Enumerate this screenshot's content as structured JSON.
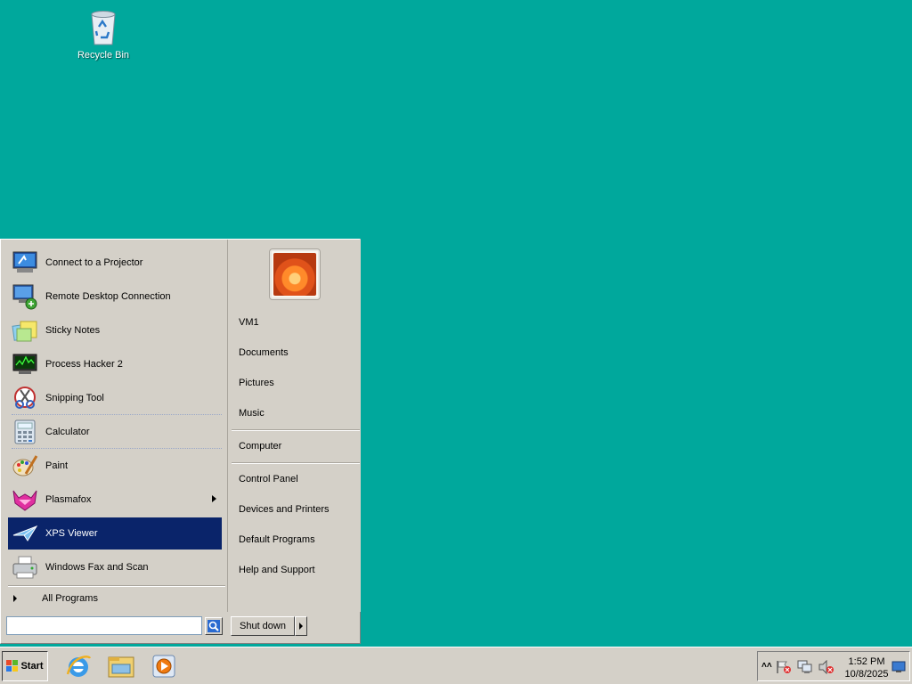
{
  "desktop": {
    "background_color": "#00a89c",
    "icons": [
      {
        "label": "Recycle Bin",
        "icon": "recycle-bin-icon"
      }
    ]
  },
  "start_menu": {
    "programs": [
      {
        "label": "Connect to a Projector",
        "icon": "projector-icon"
      },
      {
        "label": "Remote Desktop Connection",
        "icon": "remote-desktop-icon"
      },
      {
        "label": "Sticky Notes",
        "icon": "sticky-notes-icon"
      },
      {
        "label": "Process Hacker 2",
        "icon": "process-hacker-icon"
      },
      {
        "label": "Snipping Tool",
        "icon": "snipping-tool-icon"
      },
      {
        "label": "Calculator",
        "icon": "calculator-icon"
      },
      {
        "label": "Paint",
        "icon": "paint-icon"
      },
      {
        "label": "Plasmafox",
        "icon": "plasmafox-icon",
        "has_submenu": true
      },
      {
        "label": "XPS Viewer",
        "icon": "xps-viewer-icon",
        "selected": true
      },
      {
        "label": "Windows Fax and Scan",
        "icon": "fax-scan-icon"
      }
    ],
    "all_programs_label": "All Programs",
    "search": {
      "value": "",
      "placeholder": ""
    },
    "places": {
      "user": "VM1",
      "documents": "Documents",
      "pictures": "Pictures",
      "music": "Music",
      "computer": "Computer",
      "control_panel": "Control Panel",
      "devices_printers": "Devices and Printers",
      "default_programs": "Default Programs",
      "help_support": "Help and Support"
    },
    "shutdown_label": "Shut down",
    "selected_color": "#0a246a"
  },
  "taskbar": {
    "start_label": "Start",
    "pinned": [
      "internet-explorer-icon",
      "windows-explorer-icon",
      "media-player-icon"
    ],
    "tray": {
      "icons": [
        "action-center-flag-icon",
        "network-icon",
        "volume-muted-icon"
      ],
      "time": "1:52 PM",
      "date": "10/8/2025"
    }
  }
}
